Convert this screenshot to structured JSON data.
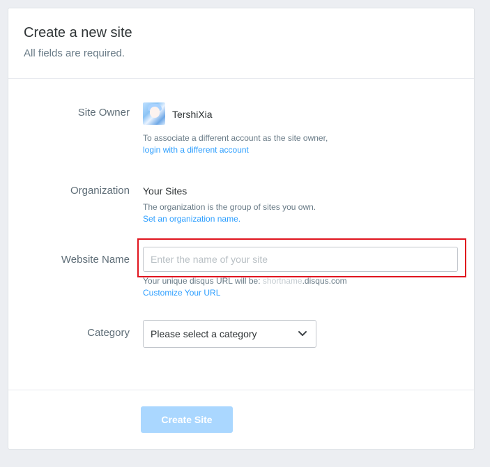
{
  "header": {
    "title": "Create a new site",
    "subtitle": "All fields are required."
  },
  "site_owner": {
    "label": "Site Owner",
    "username": "TershiXia",
    "help_text": "To associate a different account as the site owner,",
    "link": "login with a different account"
  },
  "organization": {
    "label": "Organization",
    "value": "Your Sites",
    "help_text": "The organization is the group of sites you own.",
    "link": "Set an organization name."
  },
  "website_name": {
    "label": "Website Name",
    "placeholder": "Enter the name of your site",
    "value": "",
    "url_prefix": "Your unique disqus URL will be: ",
    "url_shortname": "shortname",
    "url_suffix": ".disqus.com",
    "link": "Customize Your URL"
  },
  "category": {
    "label": "Category",
    "selected": "Please select a category"
  },
  "footer": {
    "create_button": "Create Site"
  },
  "colors": {
    "link": "#2e9fff",
    "button_disabled": "#aad7ff",
    "highlight": "#e0141e"
  },
  "icons": {
    "select_arrow": "chevron-down-icon",
    "avatar": "user-avatar"
  }
}
